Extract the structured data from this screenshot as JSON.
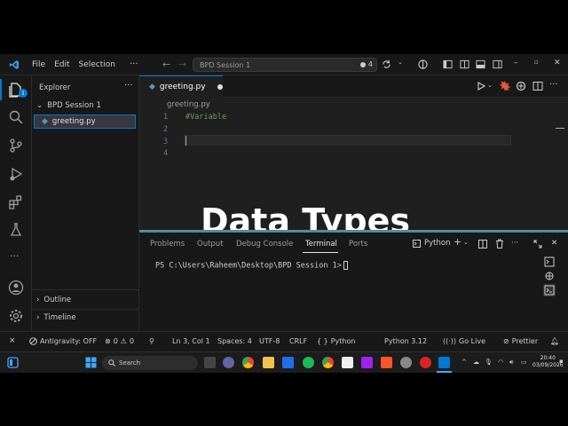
{
  "titlebar": {
    "menu": [
      "File",
      "Edit",
      "Selection"
    ],
    "more": "···",
    "command_center": "BPD Session 1",
    "ext_count": "4"
  },
  "sidebar": {
    "title": "Explorer",
    "more": "···",
    "folder": "BPD Session 1",
    "file": "greeting.py",
    "outline": "Outline",
    "timeline": "Timeline"
  },
  "activity_badge": "1",
  "editor": {
    "tab_label": "greeting.py",
    "breadcrumb": "greeting.py",
    "line_numbers": [
      "1",
      "2",
      "3",
      "4"
    ],
    "lines": [
      "#Variable",
      "",
      "",
      ""
    ],
    "overlay_title": "Data Types"
  },
  "panel": {
    "tabs": [
      "Problems",
      "Output",
      "Debug Console",
      "Terminal",
      "Ports"
    ],
    "active_tab": "Terminal",
    "shell": "Python",
    "terminal_prompt": "PS C:\\Users\\Raheem\\Desktop\\BPD Session 1>"
  },
  "statusbar": {
    "remote": "⨯",
    "antigravity": "Antigravity: OFF",
    "errors": "0",
    "warnings": "0",
    "position": "Ln 3, Col 1",
    "spaces": "Spaces: 4",
    "encoding": "UTF-8",
    "eol": "CRLF",
    "language": "Python",
    "interpreter": "Python 3.12",
    "golive": "Go Live",
    "prettier": "Prettier"
  },
  "taskbar": {
    "search": "Search",
    "time": "20:40",
    "date": "03/09/2026"
  },
  "colors": {
    "accent": "#0078d4",
    "editor_bg": "#1f1f1f",
    "chrome_bg": "#181818",
    "comment": "#6a9955"
  }
}
